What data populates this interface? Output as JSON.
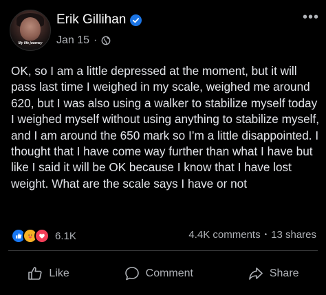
{
  "post": {
    "author": "Erik Gillihan",
    "avatar_caption": "My life journey",
    "date": "Jan 15",
    "separator": "·",
    "text": "OK, so I am a little depressed at the moment, but it will pass last time I weighed in my scale, weighed me around 620, but I was also using a walker to stabilize myself today I weighed myself without using anything to stabilize myself, and I am around the 650 mark so I’m a little disappointed. I thought that I have come way further than what I have but like I said it will be OK because I know that I have lost weight. What are the scale says I have or not"
  },
  "reactions": {
    "count": "6.1K",
    "types": [
      "like",
      "care",
      "love"
    ]
  },
  "stats": {
    "comments": "4.4K comments",
    "shares": "13 shares",
    "dot": "•"
  },
  "actions": {
    "like": "Like",
    "comment": "Comment",
    "share": "Share"
  },
  "colors": {
    "background": "#000000",
    "verified": "#1b74e4",
    "secondary_text": "#b0b3b8"
  }
}
